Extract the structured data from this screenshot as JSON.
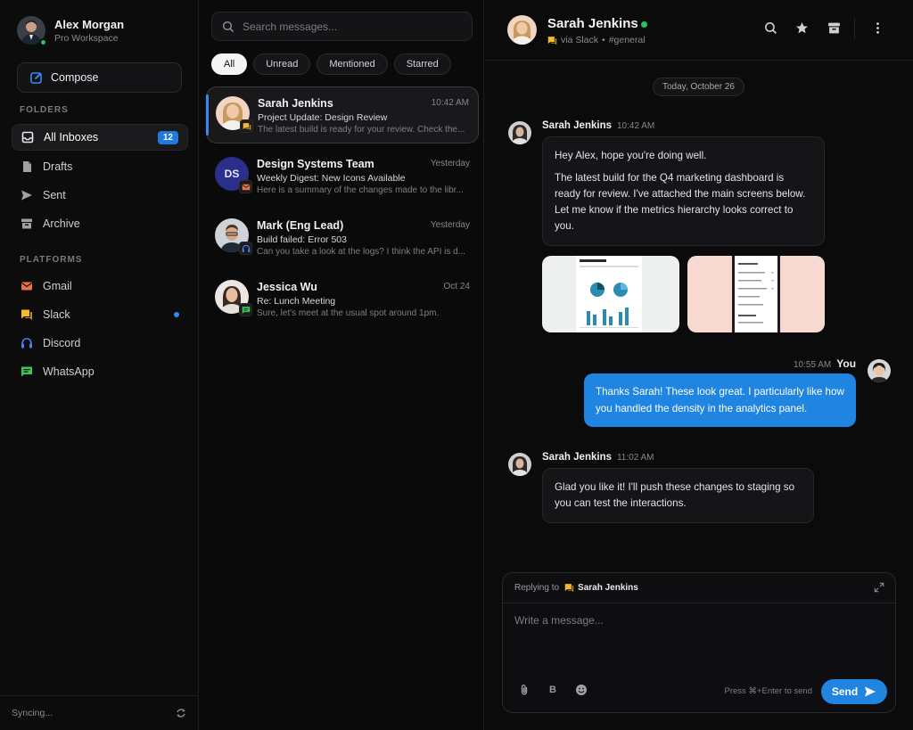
{
  "colors": {
    "accent": "#1f85e0",
    "online": "#22c55e",
    "slack": "#f5b82e",
    "gmail": "#e8734a",
    "discord": "#4c7cf0",
    "whatsapp": "#3fc45a",
    "compose": "#2f8df0"
  },
  "profile": {
    "name": "Alex Morgan",
    "workspace": "Pro Workspace"
  },
  "compose_label": "Compose",
  "folders": {
    "label": "FOLDERS",
    "items": [
      {
        "label": "All Inboxes",
        "icon": "inbox-icon",
        "badge": "12"
      },
      {
        "label": "Drafts",
        "icon": "draft-icon"
      },
      {
        "label": "Sent",
        "icon": "send-icon"
      },
      {
        "label": "Archive",
        "icon": "archive-icon"
      }
    ]
  },
  "platforms": {
    "label": "PLATFORMS",
    "items": [
      {
        "label": "Gmail",
        "icon": "gmail-icon"
      },
      {
        "label": "Slack",
        "icon": "slack-icon",
        "unread": true
      },
      {
        "label": "Discord",
        "icon": "discord-icon"
      },
      {
        "label": "WhatsApp",
        "icon": "whatsapp-icon"
      }
    ]
  },
  "sync_status": "Syncing...",
  "search": {
    "placeholder": "Search messages..."
  },
  "filters": [
    "All",
    "Unread",
    "Mentioned",
    "Starred"
  ],
  "messages": [
    {
      "sender": "Sarah Jenkins",
      "time": "10:42 AM",
      "subject": "Project Update: Design Review",
      "preview": "The latest build is ready for your review. Check the...",
      "platform": "slack-icon"
    },
    {
      "sender": "Design Systems Team",
      "initials": "DS",
      "time": "Yesterday",
      "subject": "Weekly Digest: New Icons Available",
      "preview": "Here is a summary of the changes made to the libr...",
      "platform": "gmail-icon"
    },
    {
      "sender": "Mark (Eng Lead)",
      "time": "Yesterday",
      "subject": "Build failed: Error 503",
      "preview": "Can you take a look at the logs? I think the API is d...",
      "platform": "discord-icon"
    },
    {
      "sender": "Jessica Wu",
      "time": "Oct 24",
      "subject": "Re: Lunch Meeting",
      "preview": "Sure, let's meet at the usual spot around 1pm.",
      "platform": "whatsapp-icon"
    }
  ],
  "chat": {
    "name": "Sarah Jenkins",
    "via": "via Slack",
    "channel": "#general",
    "date": "Today, October 26",
    "thread": [
      {
        "sender": "Sarah Jenkins",
        "time": "10:42 AM",
        "paragraphs": [
          "Hey Alex, hope you're doing well.",
          "The latest build for the Q4 marketing dashboard is ready for review. I've attached the main screens below. Let me know if the metrics hierarchy looks correct to you."
        ]
      },
      {
        "sender": "You",
        "time": "10:55 AM",
        "text": "Thanks Sarah! These look great. I particularly like how you handled the density in the analytics panel."
      },
      {
        "sender": "Sarah Jenkins",
        "time": "11:02 AM",
        "text": "Glad you like it! I'll push these changes to staging so you can test the interactions."
      }
    ]
  },
  "composer": {
    "replying_label": "Replying to",
    "replying_name": "Sarah Jenkins",
    "placeholder": "Write a message...",
    "bold_label": "B",
    "hint": "Press ⌘+Enter to send",
    "send_label": "Send"
  }
}
